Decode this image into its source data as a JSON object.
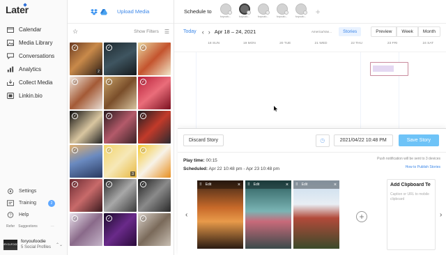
{
  "brand": {
    "logo": "Later",
    "logo_sub": ""
  },
  "sidebar": {
    "items": [
      {
        "label": "Calendar",
        "icon": "calendar-icon"
      },
      {
        "label": "Media Library",
        "icon": "media-library-icon"
      },
      {
        "label": "Conversations",
        "icon": "conversations-icon"
      },
      {
        "label": "Analytics",
        "icon": "analytics-icon"
      },
      {
        "label": "Collect Media",
        "icon": "collect-media-icon"
      },
      {
        "label": "Linkin.bio",
        "icon": "linkinbio-icon"
      }
    ],
    "bottom_items": [
      {
        "label": "Settings",
        "icon": "gear-icon"
      },
      {
        "label": "Training",
        "icon": "training-icon",
        "badge": "2"
      },
      {
        "label": "Help",
        "icon": "help-icon"
      }
    ],
    "refer": "Refer",
    "suggestions": "Suggestions",
    "more": "···",
    "profile": {
      "name": "foryoufoodie",
      "sub": "5 Social Profiles",
      "avatar_text": "FORYOUFOODIE"
    }
  },
  "media": {
    "upload_label": "Upload Media",
    "show_filters": "Show Filters",
    "thumbs": [
      {
        "bg": "linear-gradient(135deg,#6b3b22,#c98a4a 45%,#2a1c14)",
        "count": "2"
      },
      {
        "bg": "linear-gradient(150deg,#1e2a30,#3f5560 50%,#15191c)",
        "count": ""
      },
      {
        "bg": "linear-gradient(135deg,#e8d6a0,#c4542e 50%,#f2e6c8)",
        "count": ""
      },
      {
        "bg": "linear-gradient(135deg,#f0e6dc,#a45a36 50%,#e8ddd4)",
        "count": ""
      },
      {
        "bg": "linear-gradient(135deg,#c9a46a,#7a4e2a 50%,#d8c4a0)",
        "count": ""
      },
      {
        "bg": "linear-gradient(140deg,#b8203a,#ea6d7a 50%,#7a1020)",
        "count": ""
      },
      {
        "bg": "linear-gradient(135deg,#101010,#d9c6a0 55%,#222)",
        "count": ""
      },
      {
        "bg": "linear-gradient(135deg,#2a1a1e,#b45a6a 50%,#3a2226)",
        "count": ""
      },
      {
        "bg": "linear-gradient(135deg,#1c1c22,#c23a2a 50%,#2a2a30)",
        "count": ""
      },
      {
        "bg": "linear-gradient(160deg,#e0b070,#6a8ac0 45%,#2a3a60)",
        "count": ""
      },
      {
        "bg": "linear-gradient(135deg,#f3d46a,#f6e8b8 50%,#e8b840)",
        "count": "3"
      },
      {
        "bg": "linear-gradient(135deg,#f4c830,#f7f2e8 50%,#e89020)",
        "count": ""
      },
      {
        "bg": "linear-gradient(135deg,#6a2a32,#c86a6a 50%,#3a1a1e)",
        "count": ""
      },
      {
        "bg": "linear-gradient(135deg,#2a2a2a,#a8a8a8 50%,#3a3a3a)",
        "count": ""
      },
      {
        "bg": "linear-gradient(135deg,#1e1e1e,#8a8a8a 50%,#2a2a2a)",
        "count": ""
      },
      {
        "bg": "linear-gradient(135deg,#e8e0ea,#8a6a8a 50%,#c4b4c8)",
        "count": ""
      },
      {
        "bg": "linear-gradient(135deg,#1a0a2a,#6a2a8a 50%,#2a0a3a)",
        "count": ""
      },
      {
        "bg": "linear-gradient(135deg,#d8d0c8,#7a6a5a 50%,#c8beb2)",
        "count": ""
      }
    ]
  },
  "schedule": {
    "label": "Schedule to",
    "profiles": [
      {
        "name": "foryoufo..."
      },
      {
        "name": "foryoufo...",
        "active": true
      },
      {
        "name": "foryoufo..."
      },
      {
        "name": "foryoufo..."
      },
      {
        "name": "foryoufo..."
      }
    ]
  },
  "calendar": {
    "today": "Today",
    "range": "Apr 18 – 24, 2021",
    "timezone": "America/Van...",
    "stories_label": "Stories",
    "views": [
      "Preview",
      "Week",
      "Month"
    ],
    "days": [
      {
        "label": "18 SUN",
        "sub": ""
      },
      {
        "label": "19 MON",
        "sub": ""
      },
      {
        "label": "20 TUE",
        "sub": ""
      },
      {
        "label": "21 WED",
        "sub": ""
      },
      {
        "label": "22 THU",
        "sub": ""
      },
      {
        "label": "23 FRI",
        "sub": ""
      },
      {
        "label": "24 SAT",
        "sub": ""
      }
    ]
  },
  "editor": {
    "discard": "Discard Story",
    "date_value": "2021/04/22 10:48 PM",
    "save": "Save Story",
    "play_time_label": "Play time:",
    "play_time_value": "00:15",
    "scheduled_label": "Scheduled:",
    "scheduled_value": "Apr 22 10:48 pm - Apr 23 10:48 pm",
    "push_note": "Push notification will be sent to 3 devices",
    "how_to": "How to Publish Stories",
    "edit_label": "Edit",
    "frames": [
      {
        "bg": "linear-gradient(180deg,#3a2416,#c86a2a 40%,#e89a4a 60%,#2a1a12)"
      },
      {
        "bg": "linear-gradient(180deg,#2a5a5a,#7ab4b4 45%,#c86a7a 60%,#3a4a4a)"
      },
      {
        "bg": "linear-gradient(180deg,#c8dced,#e8eef4 35%,#b24a3a 55%,#3a4a2a)"
      }
    ],
    "clipboard_title": "Add Clipboard Te",
    "clipboard_placeholder": "Caption or URL to mobile clipboard"
  }
}
